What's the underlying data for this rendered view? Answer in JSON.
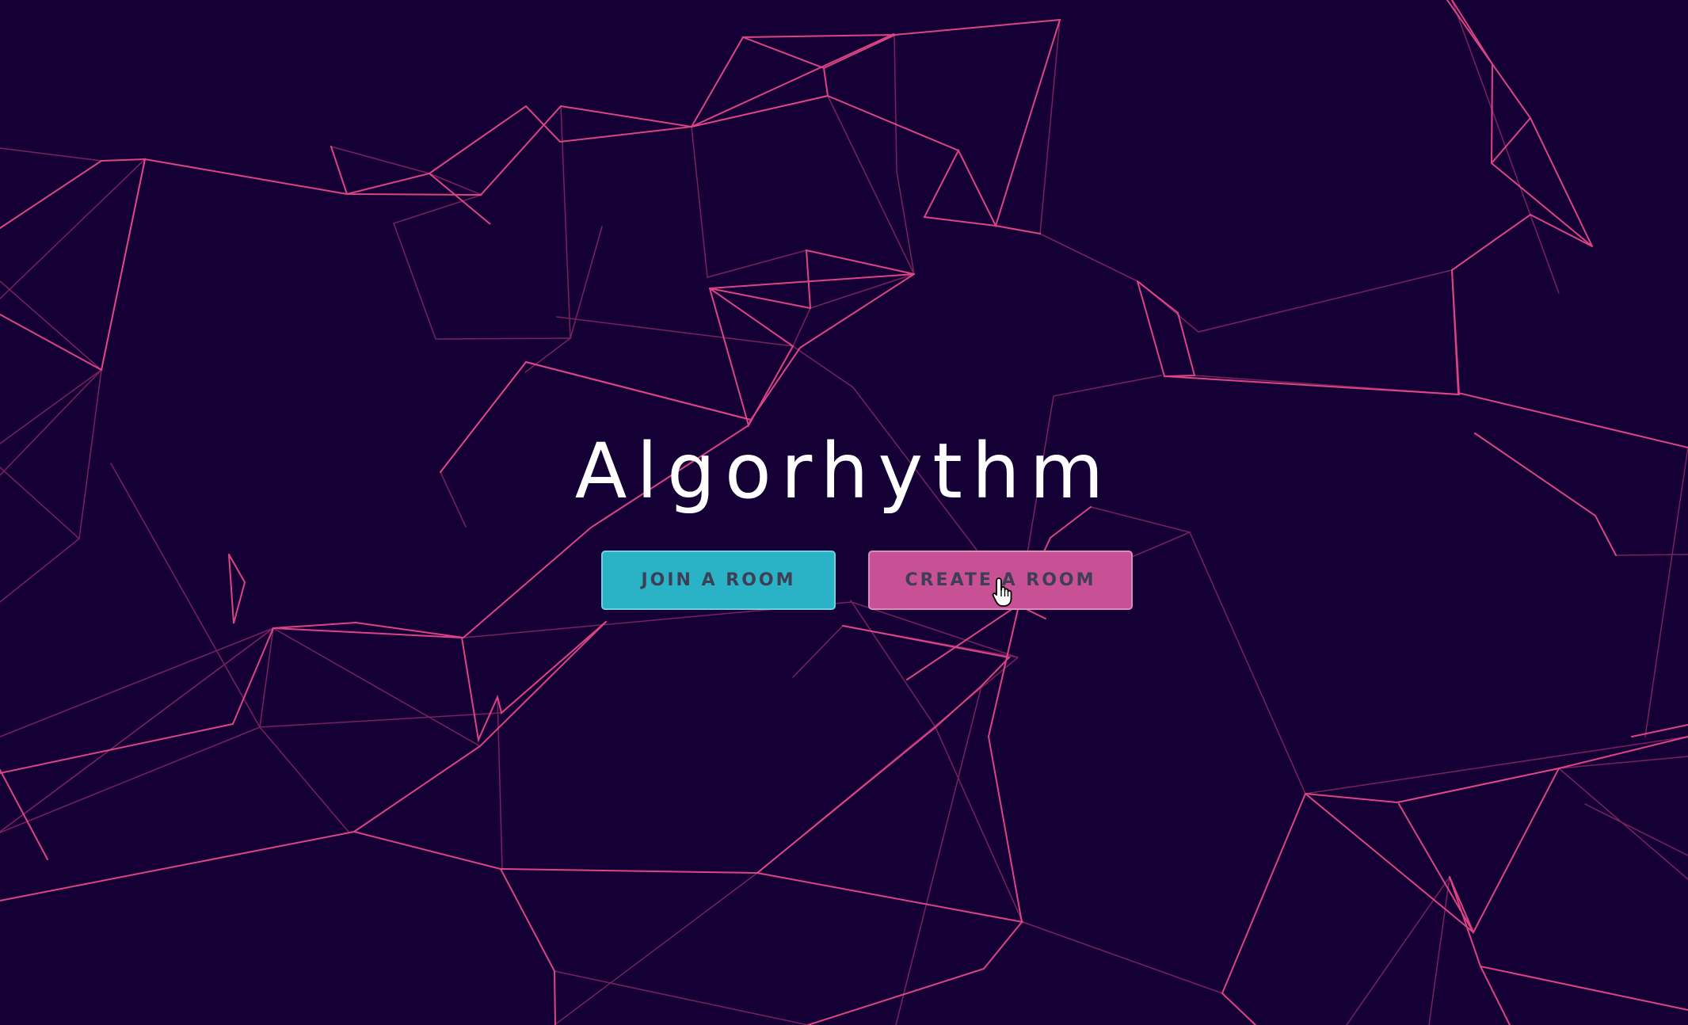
{
  "app": {
    "title": "Algorhythm"
  },
  "actions": {
    "join_label": "JOIN A ROOM",
    "create_label": "CREATE A ROOM"
  },
  "theme": {
    "background": "#150036",
    "line_color": "#f04c8c",
    "join_color": "#2ab2c6",
    "create_color": "#c85196",
    "title_color": "#ffffff"
  },
  "icons": {
    "pointer": "hand-pointer-icon"
  }
}
